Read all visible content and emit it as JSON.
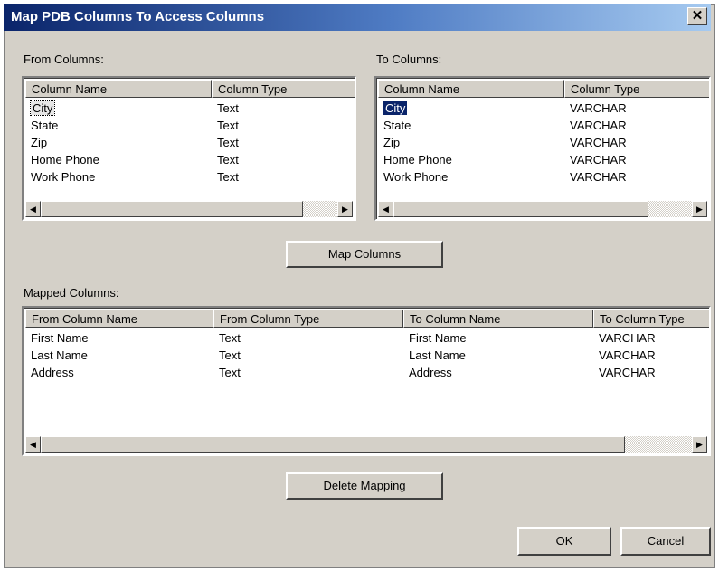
{
  "title": "Map PDB Columns To Access Columns",
  "close_glyph": "✕",
  "from": {
    "label": "From Columns:",
    "headers": [
      "Column Name",
      "Column Type"
    ],
    "rows": [
      [
        "City",
        "Text"
      ],
      [
        "State",
        "Text"
      ],
      [
        "Zip",
        "Text"
      ],
      [
        "Home Phone",
        "Text"
      ],
      [
        "Work Phone",
        "Text"
      ]
    ]
  },
  "to": {
    "label": "To Columns:",
    "headers": [
      "Column Name",
      "Column Type"
    ],
    "rows": [
      [
        "City",
        "VARCHAR"
      ],
      [
        "State",
        "VARCHAR"
      ],
      [
        "Zip",
        "VARCHAR"
      ],
      [
        "Home Phone",
        "VARCHAR"
      ],
      [
        "Work Phone",
        "VARCHAR"
      ]
    ]
  },
  "map_button": "Map Columns",
  "mapped": {
    "label": "Mapped Columns:",
    "headers": [
      "From Column Name",
      "From Column Type",
      "To Column Name",
      "To Column Type"
    ],
    "rows": [
      [
        "First Name",
        "Text",
        "First Name",
        "VARCHAR"
      ],
      [
        "Last Name",
        "Text",
        "Last Name",
        "VARCHAR"
      ],
      [
        "Address",
        "Text",
        "Address",
        "VARCHAR"
      ]
    ]
  },
  "delete_button": "Delete Mapping",
  "ok_button": "OK",
  "cancel_button": "Cancel",
  "scroll_left_glyph": "◀",
  "scroll_right_glyph": "▶"
}
